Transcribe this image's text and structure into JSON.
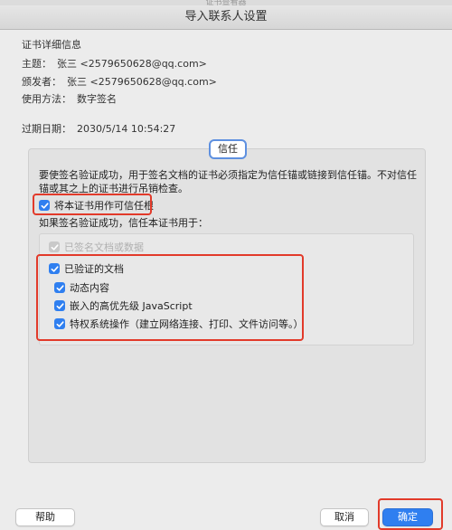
{
  "window": {
    "title": "导入联系人设置",
    "behind_title": "证书查看器"
  },
  "details": {
    "section_title": "证书详细信息",
    "subject_label": "主题：",
    "subject_value": "张三 <2579650628@qq.com>",
    "issuer_label": "颁发者：",
    "issuer_value": "张三 <2579650628@qq.com>",
    "usage_label": "使用方法：",
    "usage_value": "数字签名",
    "expiry_label": "过期日期：",
    "expiry_value": "2030/5/14 10:54:27"
  },
  "trust": {
    "tab_label": "信任",
    "description": "要使签名验证成功，用于签名文档的证书必须指定为信任锚或链接到信任锚。不对信任锚或其之上的证书进行吊销检查。",
    "trusted_root_label": "将本证书用作可信任根",
    "subtitle": "如果签名验证成功，信任本证书用于：",
    "options": {
      "signed_docs": "已签名文档或数据",
      "certified_docs": "已验证的文档",
      "dynamic_content": "动态内容",
      "javascript": "嵌入的高优先级 JavaScript",
      "privileged_ops": "特权系统操作（建立网络连接、打印、文件访问等。）"
    }
  },
  "buttons": {
    "help": "帮助",
    "cancel": "取消",
    "ok": "确定"
  },
  "colors": {
    "accent": "#2f7ff0",
    "highlight": "#e23a2a"
  }
}
